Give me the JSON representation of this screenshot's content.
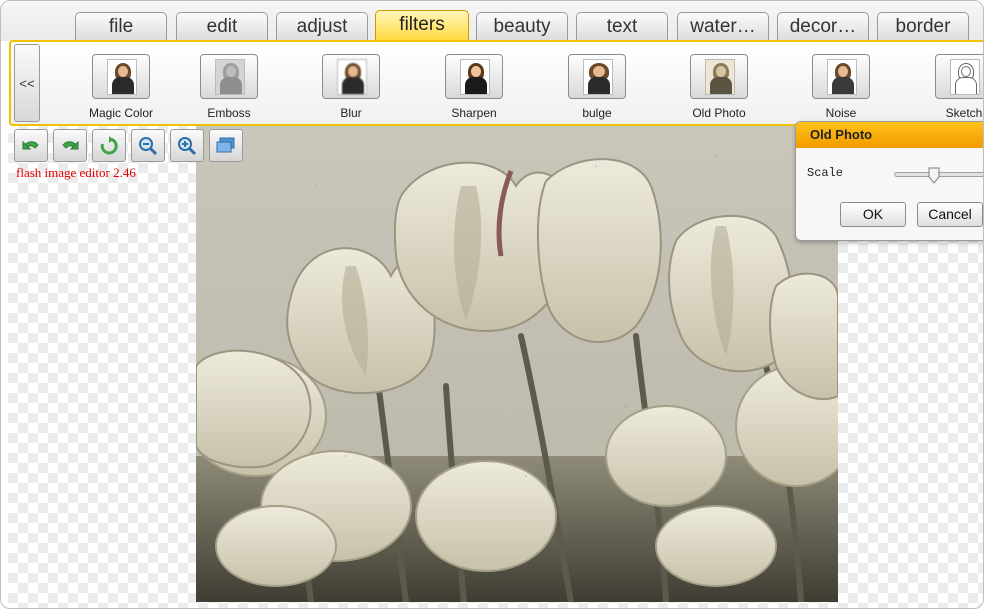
{
  "tabs": [
    {
      "label": "file"
    },
    {
      "label": "edit"
    },
    {
      "label": "adjust"
    },
    {
      "label": "filters",
      "active": true
    },
    {
      "label": "beauty"
    },
    {
      "label": "text"
    },
    {
      "label": "water…"
    },
    {
      "label": "decor…"
    },
    {
      "label": "border"
    }
  ],
  "filter_strip": {
    "back_label": "<<",
    "items": [
      {
        "label": "Magic Color",
        "style": "color"
      },
      {
        "label": "Emboss",
        "style": "emboss"
      },
      {
        "label": "Blur",
        "style": "color"
      },
      {
        "label": "Sharpen",
        "style": "color"
      },
      {
        "label": "bulge",
        "style": "color"
      },
      {
        "label": "Old Photo",
        "style": "sepia"
      },
      {
        "label": "Noise",
        "style": "color"
      },
      {
        "label": "Sketch",
        "style": "sketch"
      }
    ]
  },
  "toolbar": {
    "tools": [
      {
        "icon": "undo-icon"
      },
      {
        "icon": "redo-icon"
      },
      {
        "icon": "reset-icon"
      },
      {
        "icon": "zoom-out-icon"
      },
      {
        "icon": "zoom-in-icon"
      },
      {
        "icon": "screen-icon"
      }
    ],
    "version_text": "flash image editor 2.46"
  },
  "dialog": {
    "title": "Old Photo",
    "scale_label": "Scale",
    "scale_value": 0.4,
    "ok_label": "OK",
    "cancel_label": "Cancel"
  },
  "colors": {
    "accent": "#ffd83a",
    "dialog_title": "#f7a800",
    "version_text": "#e00000"
  }
}
